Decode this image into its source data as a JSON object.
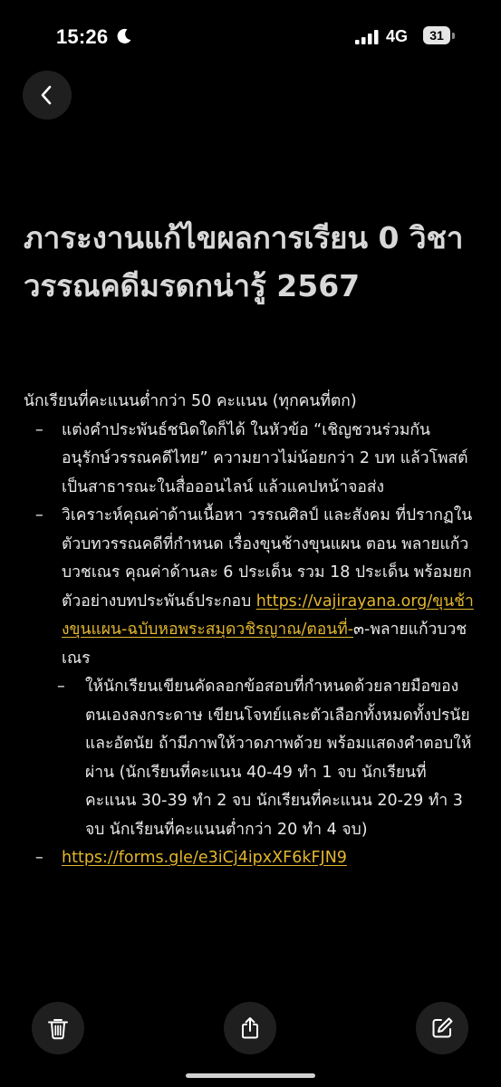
{
  "status_bar": {
    "time": "15:26",
    "network": "4G",
    "battery": "31"
  },
  "title": "ภาระงานแก้ไขผลการเรียน 0 วิชาวรรณคดีมรดกน่ารู้ 2567",
  "content": {
    "intro": "นักเรียนที่คะแนนต่ำกว่า 50 คะแนน (ทุกคนที่ตก)",
    "bullet1": "แต่งคำประพันธ์ชนิดใดก็ได้ ในหัวข้อ “เชิญชวนร่วมกันอนุรักษ์วรรณคดีไทย” ความยาวไม่น้อยกว่า 2 บท แล้วโพสต์เป็นสาธารณะในสื่อออนไลน์ แล้วแคปหน้าจอส่ง",
    "bullet2_text": "วิเคราะห์คุณค่าด้านเนื้อหา วรรณศิลป์ และสังคม ที่ปรากฏในตัวบทวรรณคดีที่กำหนด เรื่องขุนช้างขุนแผน ตอน พลายแก้วบวชเณร คุณค่าด้านละ 6 ประเด็น รวม 18 ประเด็น พร้อมยกตัวอย่างบทประพันธ์ประกอบ ",
    "bullet2_link": "https://vajirayana.org/ขุนช้างขุนแผน-ฉบับหอพระสมุดวชิรญาณ/ตอนที่-",
    "bullet2_suffix": "๓-พลายแก้วบวชเณร",
    "sub_bullet": "ให้นักเรียนเขียนคัดลอกข้อสอบที่กำหนดด้วยลายมือของตนเองลงกระดาษ เขียนโจทย์และตัวเลือกทั้งหมดทั้งปรนัยและอัตนัย ถ้ามีภาพให้วาดภาพด้วย พร้อมแสดงคำตอบให้ผ่าน (นักเรียนที่คะแนน 40-49 ทำ 1 จบ นักเรียนที่คะแนน 30-39 ทำ 2 จบ นักเรียนที่คะแนน 20-29 ทำ 3 จบ นักเรียนที่คะแนนต่ำกว่า 20 ทำ 4 จบ)",
    "bullet3_link": "https://forms.gle/e3iCj4ipxXF6kFJN9",
    "dash": "–"
  },
  "icons": {
    "back": "chevron-left-icon",
    "delete": "trash-icon",
    "share": "share-icon",
    "edit": "edit-icon"
  },
  "colors": {
    "background": "#000000",
    "link": "#e3b72d",
    "button_bg": "#1f1f1f"
  }
}
